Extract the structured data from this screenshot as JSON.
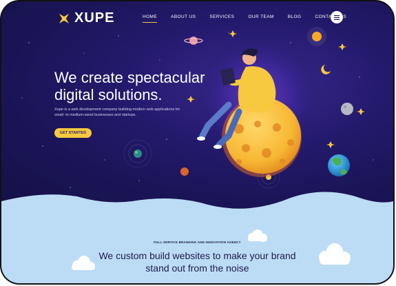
{
  "brand": {
    "name": "XUPE"
  },
  "nav": {
    "items": [
      "HOME",
      "ABOUT US",
      "SERVICES",
      "OUR TEAM",
      "BLOG",
      "CONTACT US"
    ],
    "active": "HOME"
  },
  "hero": {
    "title_line1": "We create spectacular",
    "title_line2": "digital solutions.",
    "description": "Xupe is a web development company building modern web applications for small- to medium-sized businesses and startups.",
    "cta_label": "GET STARTED"
  },
  "section": {
    "tagline": "FULL-SERVICE BRANDING AND INNOVATION AGENCY",
    "headline_line1": "We custom build websites to make your brand",
    "headline_line2": "stand out from the noise"
  },
  "colors": {
    "accent": "#f7c93e",
    "hero_bg": "#1f1863",
    "sky": "#b7d8f5"
  }
}
